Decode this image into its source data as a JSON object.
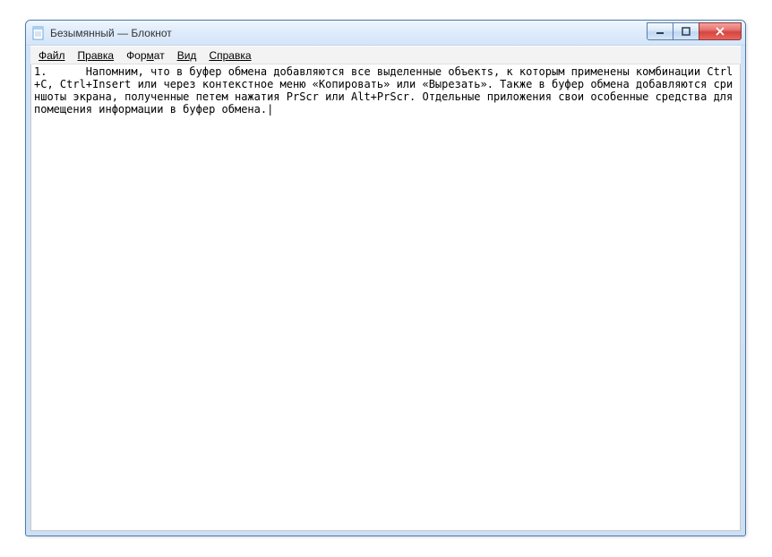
{
  "window": {
    "title": "Безымянный — Блокнот"
  },
  "menu": {
    "file": "Файл",
    "edit": "Правка",
    "format": "Формат",
    "view": "Вид",
    "help": "Справка"
  },
  "editor": {
    "content": "1.\tНапомним, что в буфер обмена добавляются все выделенные объектs, к которым применены комбинации Ctrl+C, Ctrl+Insert или через контекстное меню «Копировать» или «Вырезать». Также в буфер обмена добавляются сриншоты экрана, полученные петем нажатия PrScr или Alt+PrScr. Отдельные приложения свои особенные средства для помещения информации в буфер обмена.|"
  }
}
